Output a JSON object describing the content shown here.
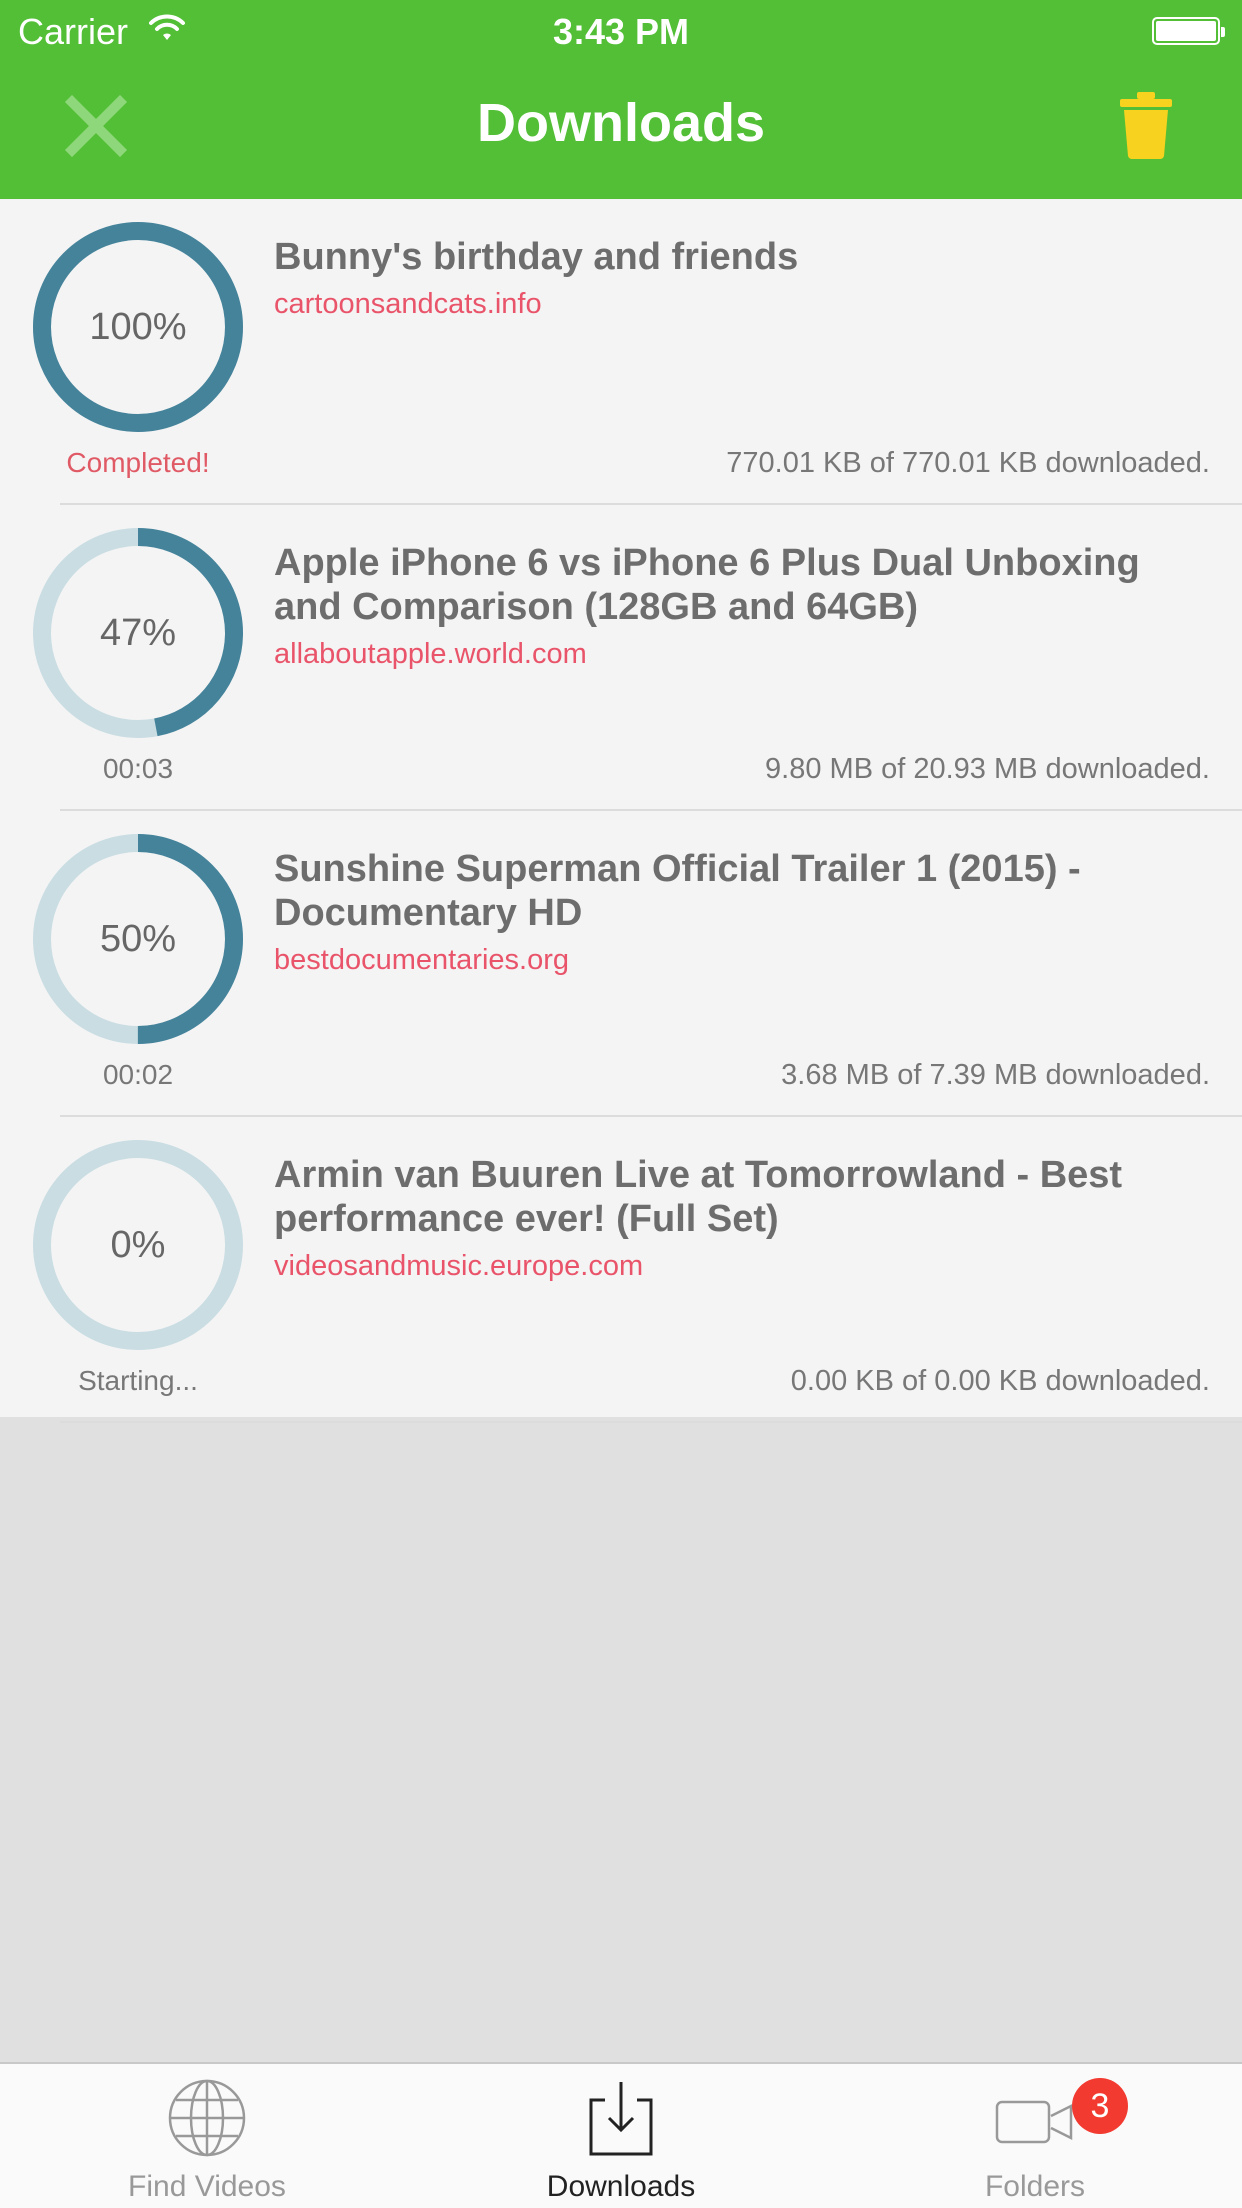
{
  "status_bar": {
    "carrier": "Carrier",
    "time": "3:43 PM"
  },
  "nav": {
    "title": "Downloads"
  },
  "colors": {
    "brand_green": "#52bf36",
    "progress_ring": "#45839b",
    "progress_track": "#c9dde3",
    "source_link": "#e9546a",
    "trash": "#f7d21e",
    "badge": "#f23a30"
  },
  "downloads": [
    {
      "title": "Bunny's birthday and friends",
      "source": "cartoonsandcats.info",
      "progress_label": "100%",
      "progress": 1.0,
      "status": "Completed!",
      "size": "770.01 KB of 770.01 KB downloaded."
    },
    {
      "title": "Apple iPhone 6 vs iPhone 6 Plus Dual Unboxing and Comparison (128GB and 64GB)",
      "source": "allaboutapple.world.com",
      "progress_label": "47%",
      "progress": 0.47,
      "status": "00:03",
      "size": "9.80 MB of 20.93 MB downloaded."
    },
    {
      "title": "Sunshine Superman Official Trailer 1 (2015) - Documentary HD",
      "source": "bestdocumentaries.org",
      "progress_label": "50%",
      "progress": 0.5,
      "status": "00:02",
      "size": "3.68 MB of 7.39 MB downloaded."
    },
    {
      "title": "Armin van Buuren Live at Tomorrowland - Best performance ever! (Full Set)",
      "source": "videosandmusic.europe.com",
      "progress_label": "0%",
      "progress": 0.0,
      "status": "Starting...",
      "size": "0.00 KB of 0.00 KB downloaded."
    }
  ],
  "tabs": [
    {
      "label": "Find Videos",
      "icon": "globe-icon",
      "selected": false
    },
    {
      "label": "Downloads",
      "icon": "download-tray-icon",
      "selected": true
    },
    {
      "label": "Folders",
      "icon": "video-camera-icon",
      "selected": false,
      "badge": "3"
    }
  ]
}
